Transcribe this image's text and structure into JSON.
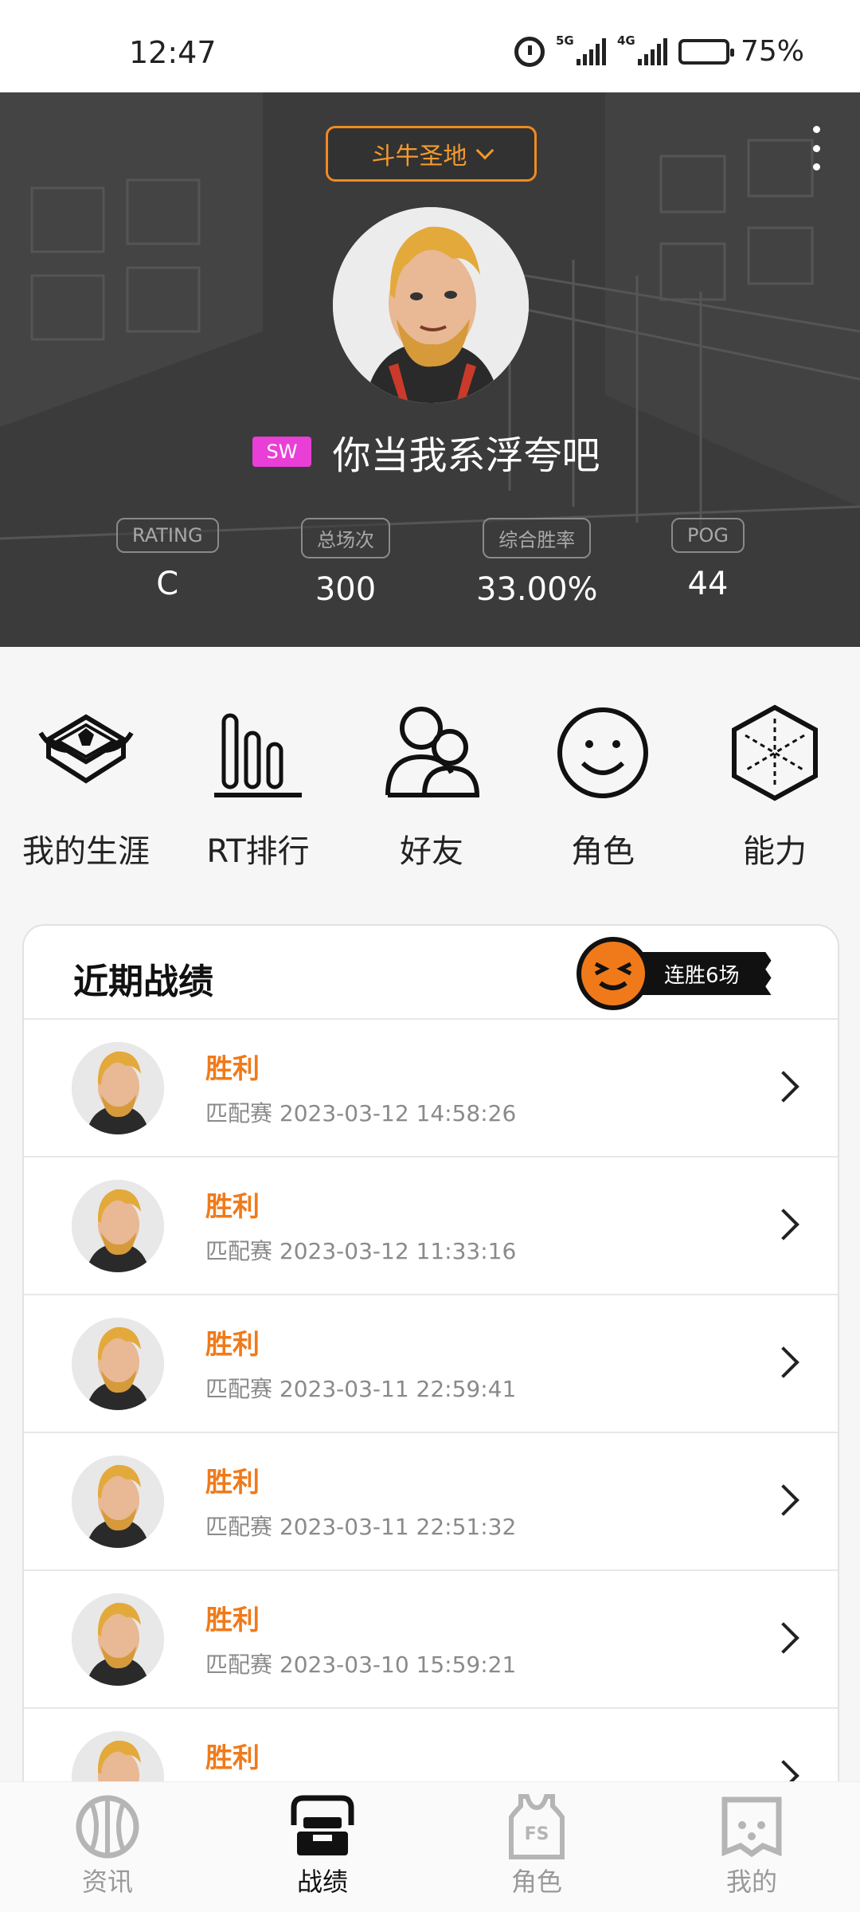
{
  "status_bar": {
    "time": "12:47",
    "signal1_tag": "5G",
    "signal2_tag": "4G",
    "battery": "75%"
  },
  "header": {
    "server_selector": "斗牛圣地",
    "player_badge": "SW",
    "player_name": "你当我系浮夸吧",
    "stats": [
      {
        "label": "RATING",
        "value": "C"
      },
      {
        "label": "总场次",
        "value": "300"
      },
      {
        "label": "综合胜率",
        "value": "33.00%"
      },
      {
        "label": "POG",
        "value": "44"
      }
    ]
  },
  "shortcuts": [
    {
      "label": "我的生涯",
      "icon": "career-emblem-icon"
    },
    {
      "label": "RT排行",
      "icon": "ranking-bars-icon"
    },
    {
      "label": "好友",
      "icon": "friends-icon"
    },
    {
      "label": "角色",
      "icon": "smiley-icon"
    },
    {
      "label": "能力",
      "icon": "ability-hexagon-icon"
    }
  ],
  "recent": {
    "title": "近期战绩",
    "streak_label": "连胜6场",
    "rows": [
      {
        "result": "胜利",
        "mode": "匹配赛",
        "time": "2023-03-12 14:58:26"
      },
      {
        "result": "胜利",
        "mode": "匹配赛",
        "time": "2023-03-12 11:33:16"
      },
      {
        "result": "胜利",
        "mode": "匹配赛",
        "time": "2023-03-11 22:59:41"
      },
      {
        "result": "胜利",
        "mode": "匹配赛",
        "time": "2023-03-11 22:51:32"
      },
      {
        "result": "胜利",
        "mode": "匹配赛",
        "time": "2023-03-10 15:59:21"
      },
      {
        "result": "胜利",
        "mode": "",
        "time": ""
      }
    ]
  },
  "bottom_nav": [
    {
      "label": "资讯",
      "icon": "basketball-icon",
      "active": false
    },
    {
      "label": "战绩",
      "icon": "hoop-icon",
      "active": true
    },
    {
      "label": "角色",
      "icon": "jersey-icon",
      "active": false
    },
    {
      "label": "我的",
      "icon": "profile-face-icon",
      "active": false
    }
  ],
  "colors": {
    "accent": "#f07a1a",
    "badge": "#e93fd7",
    "header_bg": "#3a3a3a"
  }
}
